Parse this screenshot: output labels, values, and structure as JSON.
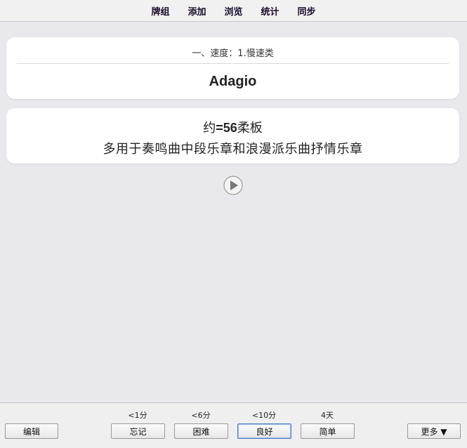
{
  "topbar": {
    "items": [
      "牌组",
      "添加",
      "浏览",
      "统计",
      "同步"
    ]
  },
  "card_front": {
    "deck_label": "一、速度：1.慢速类",
    "term": "Adagio"
  },
  "card_back": {
    "tempo_prefix": "约",
    "tempo_value": "=56",
    "tempo_suffix": "柔板",
    "description": "多用于奏鸣曲中段乐章和浪漫派乐曲抒情乐章"
  },
  "bottombar": {
    "edit_label": "编辑",
    "more_label": "更多 ▼",
    "answers": [
      {
        "time": "<1分",
        "label": "忘记"
      },
      {
        "time": "<6分",
        "label": "困难"
      },
      {
        "time": "<10分",
        "label": "良好"
      },
      {
        "time": "4天",
        "label": "简单"
      }
    ]
  }
}
